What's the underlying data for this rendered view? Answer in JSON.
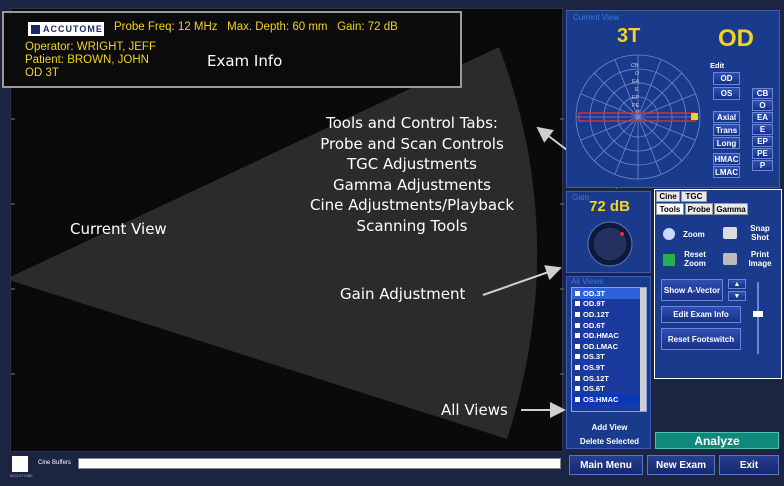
{
  "exam_info": {
    "logo_text": "ACCUTOME",
    "probe_freq": "Probe Freq: 12 MHz",
    "max_depth": "Max. Depth: 60 mm",
    "gain": "Gain: 72 dB",
    "operator": "Operator: WRIGHT, JEFF",
    "patient": "Patient: BROWN, JOHN",
    "eye_view": "OD  3T"
  },
  "annotations": {
    "exam_info": "Exam Info",
    "tools": [
      "Tools and Control Tabs:",
      "Probe and Scan Controls",
      "TGC Adjustments",
      "Gamma Adjustments",
      "Cine Adjustments/Playback",
      "Scanning Tools"
    ],
    "current_view": "Current View",
    "gain_adjustment": "Gain Adjustment",
    "all_views": "All Views"
  },
  "current_view_panel": {
    "title": "Current View",
    "view_label": "3T",
    "eye": "OD",
    "edit_label": "Edit",
    "polar_labels": [
      "CB",
      "O",
      "EA",
      "E",
      "EP",
      "PE",
      "P"
    ],
    "edit_buttons": [
      "OD",
      "OS",
      "Axial",
      "Trans",
      "Long",
      "HMAC",
      "LMAC"
    ],
    "side_buttons": [
      "CB",
      "O",
      "EA",
      "E",
      "EP",
      "PE",
      "P"
    ]
  },
  "gain_panel": {
    "title": "Gain",
    "value": "72 dB"
  },
  "tabs": {
    "row1": [
      "Cine",
      "TGC"
    ],
    "row2": [
      "Tools",
      "Probe",
      "Gamma"
    ]
  },
  "tools_panel": {
    "zoom": "Zoom",
    "snap_shot": "Snap Shot",
    "reset_zoom": "Reset Zoom",
    "print_image": "Print Image",
    "show_a_vector": "Show A-Vector",
    "edit_exam_info": "Edit Exam Info",
    "reset_footswitch": "Reset Footswitch"
  },
  "all_views": {
    "title": "All Views",
    "items": [
      "OD.3T",
      "OD.9T",
      "OD.12T",
      "OD.6T",
      "OD.HMAC",
      "OD.LMAC",
      "OS.3T",
      "OS.9T",
      "OS.12T",
      "OS.6T",
      "OS.HMAC"
    ],
    "add_view": "Add View",
    "delete_selected": "Delete Selected"
  },
  "bottom": {
    "cine_buffers": "Cine Buffers",
    "analyze": "Analyze",
    "main_menu": "Main Menu",
    "new_exam": "New Exam",
    "exit": "Exit",
    "logo_small": "ACCUTOME"
  },
  "colors": {
    "accent_yellow": "#f2d321",
    "panel_blue": "#1a3a8c",
    "analyze_teal": "#0f8a7a"
  }
}
